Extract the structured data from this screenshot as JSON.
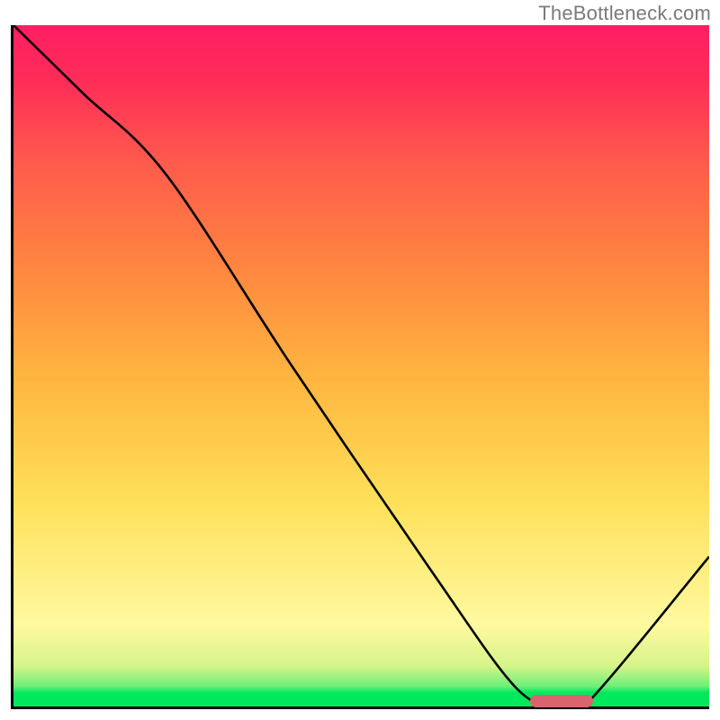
{
  "attribution": "TheBottleneck.com",
  "chart_data": {
    "type": "line",
    "title": "",
    "xlabel": "",
    "ylabel": "",
    "xlim": [
      0,
      100
    ],
    "ylim": [
      0,
      100
    ],
    "series": [
      {
        "name": "curve",
        "x": [
          0,
          10,
          22,
          40,
          60,
          72,
          78,
          82,
          100
        ],
        "y": [
          100,
          90,
          78,
          50,
          20,
          3,
          0,
          0,
          22
        ]
      }
    ],
    "marker": {
      "x_start": 74,
      "x_end": 83,
      "y": 1.2
    },
    "gradient_stops_pct": {
      "green": [
        0,
        2
      ],
      "light_green": [
        2,
        6
      ],
      "yellow": [
        6,
        30
      ],
      "orange": [
        30,
        64
      ],
      "red": [
        64,
        100
      ]
    }
  },
  "colors": {
    "axis": "#000000",
    "curve": "#000000",
    "marker": "#d9646d",
    "attribution_text": "#7a7a7a"
  }
}
